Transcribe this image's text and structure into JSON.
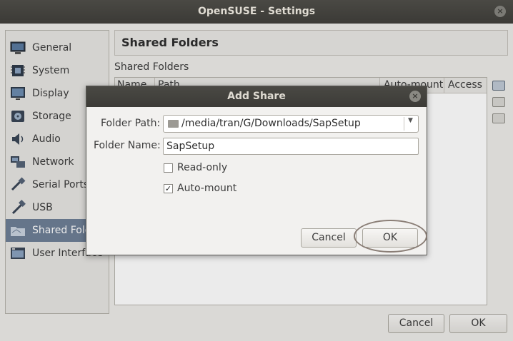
{
  "window": {
    "title": "OpenSUSE - Settings",
    "close_glyph": "×"
  },
  "sidebar": {
    "items": [
      {
        "label": "General",
        "icon": "general-icon"
      },
      {
        "label": "System",
        "icon": "system-icon"
      },
      {
        "label": "Display",
        "icon": "display-icon"
      },
      {
        "label": "Storage",
        "icon": "storage-icon"
      },
      {
        "label": "Audio",
        "icon": "audio-icon"
      },
      {
        "label": "Network",
        "icon": "network-icon"
      },
      {
        "label": "Serial Ports",
        "icon": "serial-ports-icon"
      },
      {
        "label": "USB",
        "icon": "usb-icon"
      },
      {
        "label": "Shared Folders",
        "icon": "shared-folders-icon",
        "selected": true
      },
      {
        "label": "User Interface",
        "icon": "user-interface-icon"
      }
    ]
  },
  "panel": {
    "title": "Shared Folders",
    "group_label": "Shared Folders",
    "columns": [
      "Name",
      "Path",
      "Auto-mount",
      "Access"
    ]
  },
  "footer": {
    "cancel": "Cancel",
    "ok": "OK"
  },
  "dialog": {
    "title": "Add Share",
    "close_glyph": "×",
    "folder_path_label": "Folder Path:",
    "folder_path_value": "/media/tran/G/Downloads/SapSetup",
    "dropdown_glyph": "▼",
    "folder_name_label": "Folder Name:",
    "folder_name_value": "SapSetup",
    "readonly_label": "Read-only",
    "readonly_checked": false,
    "automount_label": "Auto-mount",
    "automount_checked": true,
    "check_glyph": "✓",
    "cancel": "Cancel",
    "ok": "OK"
  },
  "colors": {
    "selection": "#6e7f96",
    "titlebar": "#3b3a36",
    "highlight_ring": "#8a7e76"
  }
}
